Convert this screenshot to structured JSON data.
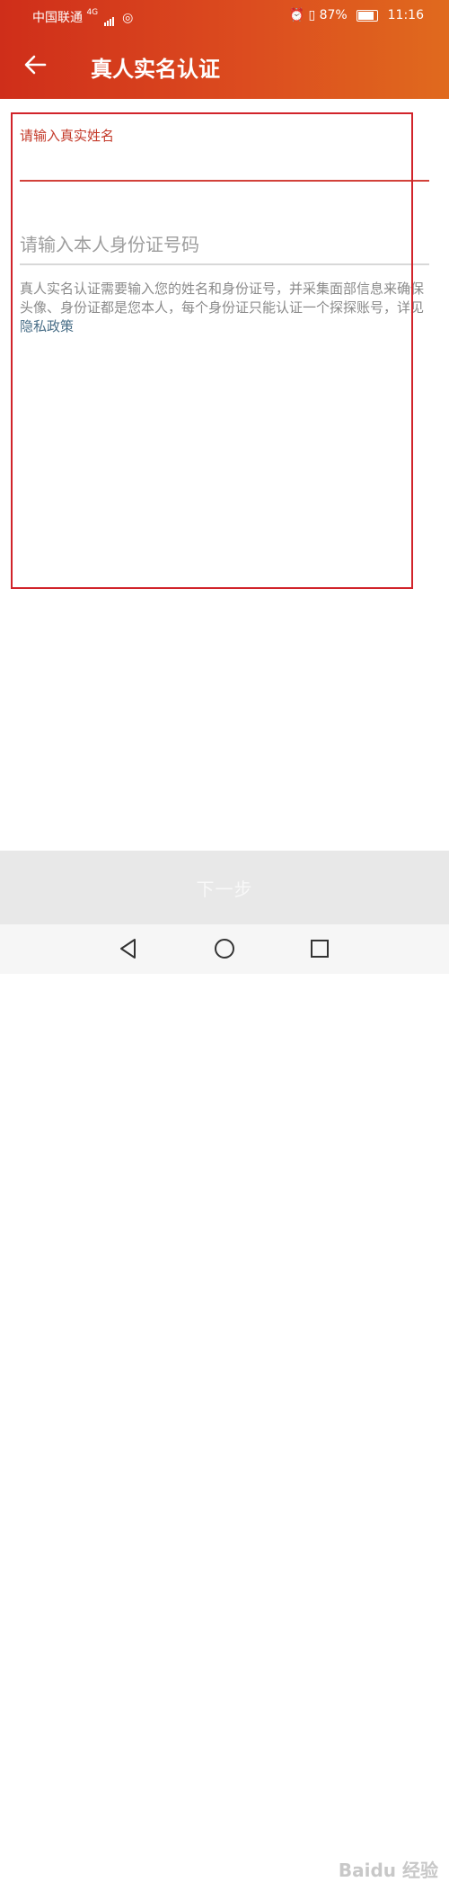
{
  "status_bar": {
    "carrier": "中国联通",
    "network": "4G",
    "battery": "87%",
    "time": "11:16"
  },
  "toolbar": {
    "back_icon": "arrow-left-icon",
    "title": "真人实名认证"
  },
  "form": {
    "name_label": "请输入真实姓名",
    "name_value": "",
    "id_placeholder": "请输入本人身份证号码",
    "description": "真人实名认证需要输入您的姓名和身份证号，并采集面部信息来确保头像、身份证都是您本人，每个身份证只能认证一个探探账号，详见",
    "privacy_link": "隐私政策"
  },
  "next_button": {
    "label": "下一步"
  },
  "nav": {
    "back_icon": "triangle-back-icon",
    "home_icon": "circle-home-icon",
    "recent_icon": "square-recent-icon"
  },
  "watermark": "Baidu 经验",
  "colors": {
    "appbar_start": "#cf2e1a",
    "appbar_end": "#e06a1e",
    "accent": "#c43a2a",
    "link": "#4a6f88",
    "highlight_box": "#d1232a"
  }
}
